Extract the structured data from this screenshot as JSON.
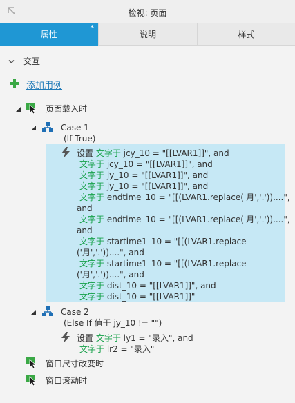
{
  "window": {
    "title": "检视: 页面"
  },
  "tabs": [
    {
      "label": "属性",
      "modified": "*"
    },
    {
      "label": "说明"
    },
    {
      "label": "样式"
    }
  ],
  "section": {
    "label": "交互"
  },
  "add_case": {
    "label": "添加用例"
  },
  "events": {
    "page_load": {
      "label": "页面载入时",
      "case1": {
        "label": "Case 1",
        "condition": "(If True)",
        "action_lead": "设置",
        "lines": [
          {
            "kw": "文字于",
            "rest": " jcy_10 = \"[[LVAR1]]\", and"
          },
          {
            "kw": "文字于",
            "rest": " jcy_10 = \"[[LVAR1]]\", and"
          },
          {
            "kw": "文字于",
            "rest": " jy_10 = \"[[LVAR1]]\", and"
          },
          {
            "kw": "文字于",
            "rest": " jy_10 = \"[[LVAR1]]\", and"
          },
          {
            "kw": "文字于",
            "rest": " endtime_10 = \"[[(LVAR1.replace('月','.'))....\","
          },
          {
            "kw": "",
            "rest": "and"
          },
          {
            "kw": "文字于",
            "rest": " endtime_10 = \"[[(LVAR1.replace('月','.'))....\","
          },
          {
            "kw": "",
            "rest": "and"
          },
          {
            "kw": "文字于",
            "rest": " startime1_10 = \"[[(LVAR1.replace"
          },
          {
            "kw": "",
            "rest": "('月','.'))....\", and"
          },
          {
            "kw": "文字于",
            "rest": " startime1_10 = \"[[(LVAR1.replace"
          },
          {
            "kw": "",
            "rest": "('月','.'))....\", and"
          },
          {
            "kw": "文字于",
            "rest": " dist_10 = \"[[LVAR1]]\", and"
          },
          {
            "kw": "文字于",
            "rest": " dist_10 = \"[[LVAR1]]\""
          }
        ]
      },
      "case2": {
        "label": "Case 2",
        "condition": "(Else If 值于 jy_10 != \"\")",
        "action_lead": "设置",
        "lines": [
          {
            "kw": "文字于",
            "rest": " ly1 = \"录入\", and"
          },
          {
            "kw": "文字于",
            "rest": " lr2 = \"录入\""
          }
        ]
      }
    },
    "resize": {
      "label": "窗口尺寸改变时"
    },
    "scroll": {
      "label": "窗口滚动时"
    }
  },
  "colors": {
    "accent": "#1f97d4",
    "selected_bg": "#c6e8f5",
    "keyword": "#17a14a",
    "link": "#1f7ab8"
  }
}
